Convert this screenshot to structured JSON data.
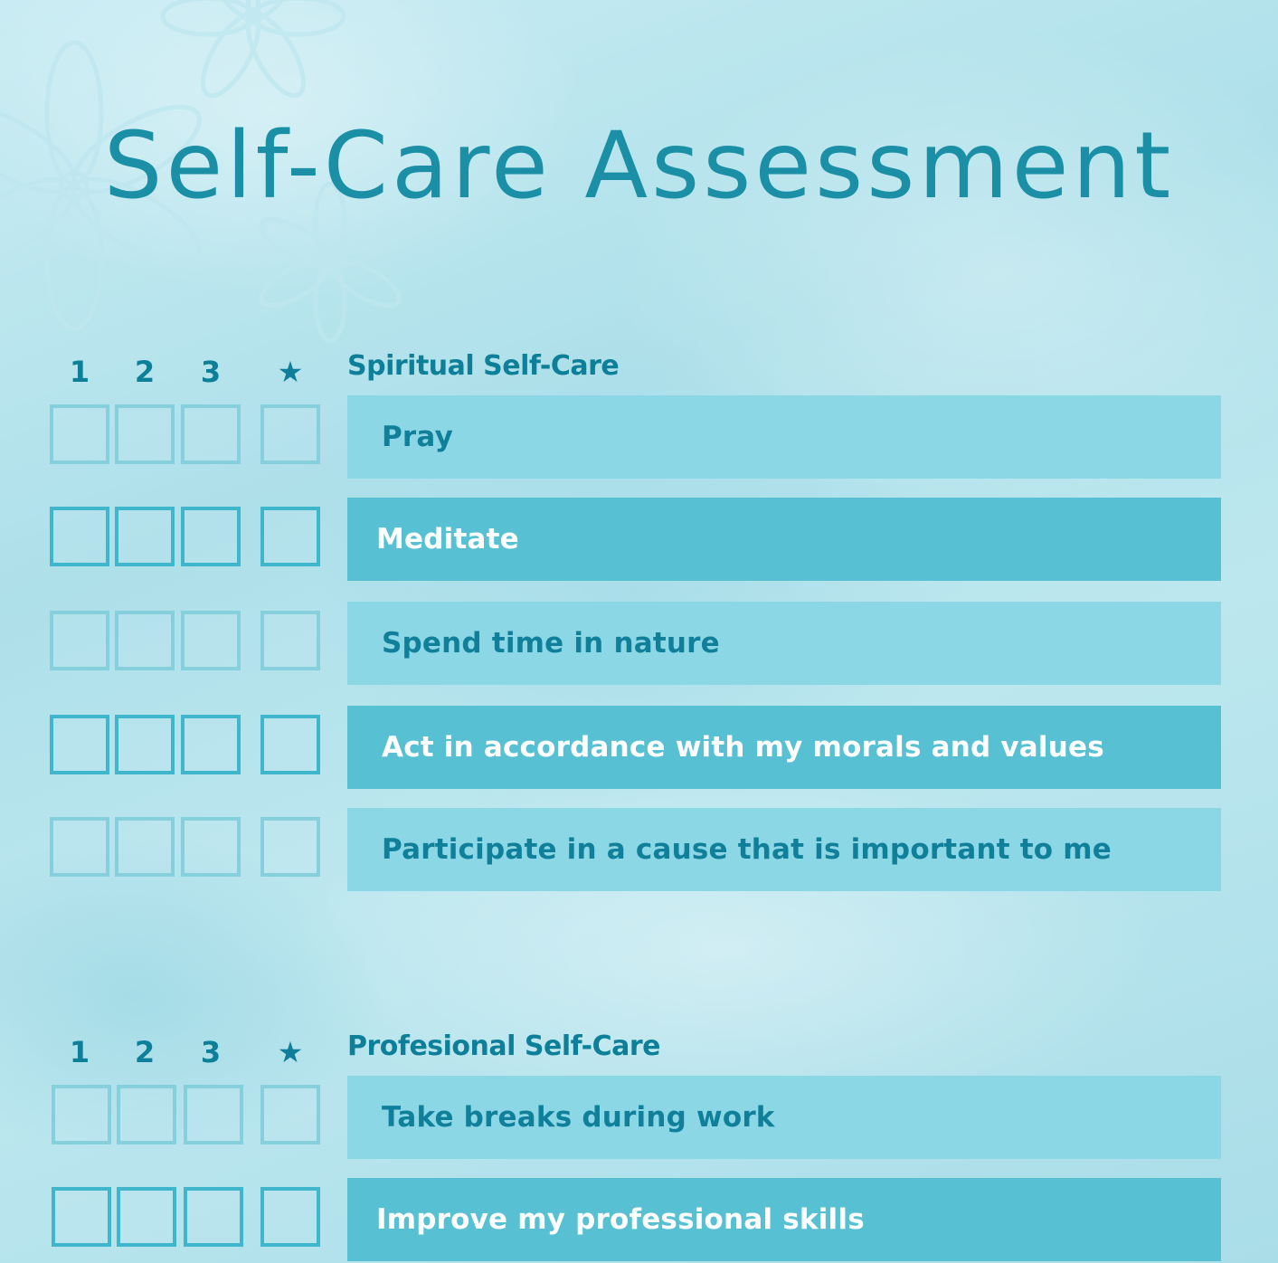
{
  "title": "Self-Care Assessment",
  "columns": [
    "1",
    "2",
    "3",
    "★"
  ],
  "sections": [
    {
      "title": "Spiritual Self-Care",
      "items": [
        "Pray",
        "Meditate",
        "Spend time in nature",
        "Act in accordance with my morals and values",
        "Participate in a cause that is important to me"
      ]
    },
    {
      "title": "Profesional Self-Care",
      "items": [
        "Take breaks during work",
        "Improve my professional skills"
      ]
    }
  ],
  "colors": {
    "accent": "#1a8fa6",
    "heading": "#0d7f98",
    "bar_light": "#8bd7e5",
    "bar_dark": "#57c1d3",
    "box_light": "#86cfdd",
    "box_dark": "#3fb6cb"
  },
  "icons": {
    "star": "star-icon",
    "decoration": "flower-icon"
  }
}
